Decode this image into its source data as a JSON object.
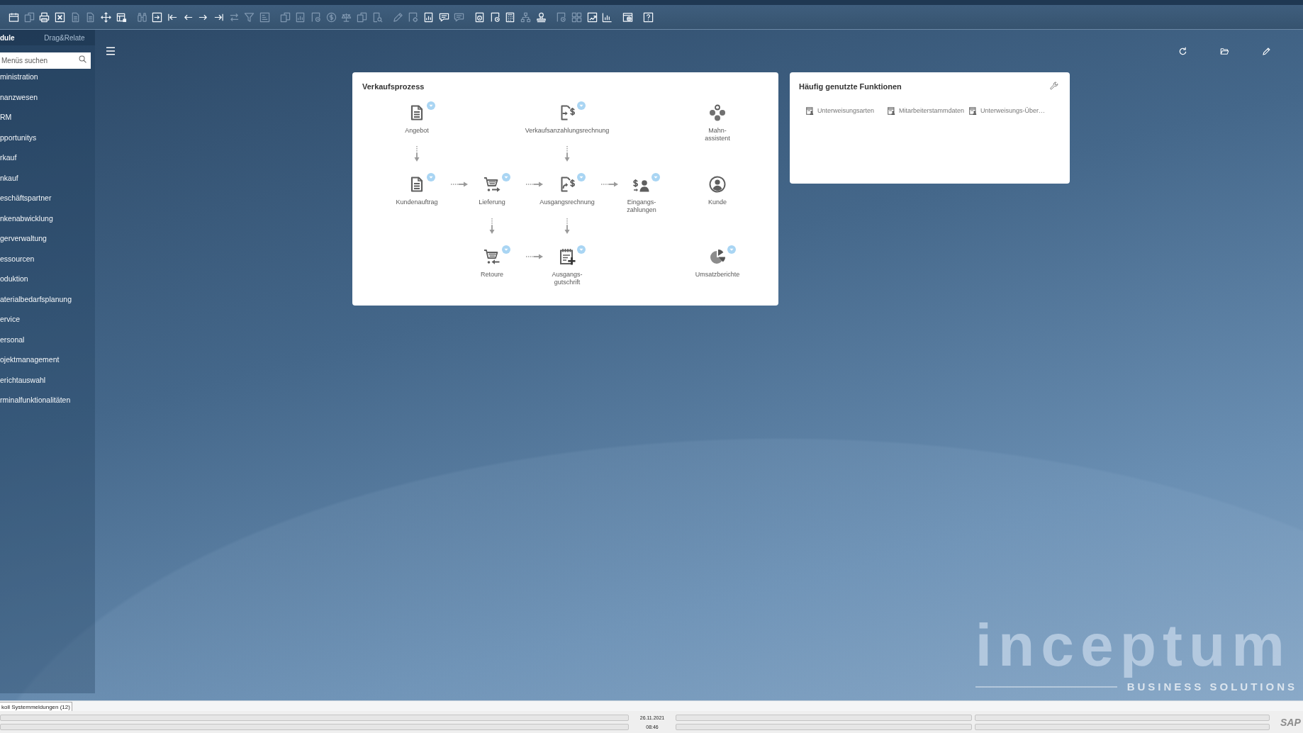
{
  "toolbar": {
    "buttons": [
      {
        "disabled": false
      },
      {
        "disabled": true
      },
      {
        "disabled": false
      },
      {
        "disabled": false
      },
      {
        "disabled": true
      },
      {
        "disabled": true
      },
      {
        "disabled": false
      },
      {
        "disabled": false
      },
      {
        "disabled": true
      },
      {
        "disabled": false
      },
      {
        "disabled": false
      },
      {
        "disabled": false
      },
      {
        "disabled": false
      },
      {
        "disabled": false
      },
      {
        "disabled": true
      },
      {
        "disabled": true
      },
      {
        "disabled": true
      },
      {
        "disabled": true
      },
      {
        "disabled": true
      },
      {
        "disabled": true
      },
      {
        "disabled": true
      },
      {
        "disabled": true
      },
      {
        "disabled": true
      },
      {
        "disabled": true
      },
      {
        "disabled": true
      },
      {
        "disabled": true
      },
      {
        "disabled": false
      },
      {
        "disabled": false
      },
      {
        "disabled": true
      },
      {
        "disabled": false
      },
      {
        "disabled": false
      },
      {
        "disabled": false
      },
      {
        "disabled": true
      },
      {
        "disabled": false
      },
      {
        "disabled": true
      },
      {
        "disabled": true
      },
      {
        "disabled": false
      },
      {
        "disabled": false
      },
      {
        "disabled": false
      },
      {
        "disabled": false
      }
    ]
  },
  "sidebar": {
    "tabs": [
      {
        "label": "dule",
        "selected": true
      },
      {
        "label": "Drag&Relate",
        "selected": false
      }
    ],
    "search": {
      "placeholder": "Menüs suchen"
    },
    "items": [
      {
        "label": "ministration"
      },
      {
        "label": "nanzwesen"
      },
      {
        "label": "RM"
      },
      {
        "label": "pportunitys"
      },
      {
        "label": "rkauf"
      },
      {
        "label": "nkauf"
      },
      {
        "label": "eschäftspartner"
      },
      {
        "label": "nkenabwicklung"
      },
      {
        "label": "gerverwaltung"
      },
      {
        "label": "essourcen"
      },
      {
        "label": "oduktion"
      },
      {
        "label": "aterialbedarfsplanung"
      },
      {
        "label": "ervice"
      },
      {
        "label": "ersonal"
      },
      {
        "label": "ojektmanagement"
      },
      {
        "label": "erichtauswahl"
      },
      {
        "label": "rminalfunktionalitäten"
      }
    ]
  },
  "sales_process": {
    "title": "Verkaufsprozess",
    "nodes": [
      {
        "label": "Angebot",
        "dropdown": true
      },
      {
        "label": "Verkaufsanzahlungsrechnung",
        "dropdown": true
      },
      {
        "label": "Mahn-\nassistent",
        "dropdown": false
      },
      {
        "label": "Kundenauftrag",
        "dropdown": true
      },
      {
        "label": "Lieferung",
        "dropdown": true
      },
      {
        "label": "Ausgangsrechnung",
        "dropdown": true
      },
      {
        "label": "Eingangs-\nzahlungen",
        "dropdown": true
      },
      {
        "label": "Kunde",
        "dropdown": false
      },
      {
        "label": "Retoure",
        "dropdown": true
      },
      {
        "label": "Ausgangs-\ngutschrift",
        "dropdown": true
      },
      {
        "label": "Umsatzberichte",
        "dropdown": true
      }
    ]
  },
  "frequent_functions": {
    "title": "Häufig genutzte Funktionen",
    "items": [
      {
        "label": "Unterweisungsarten"
      },
      {
        "label": "Mitarbeiterstammdaten"
      },
      {
        "label": "Unterweisungs-Über…"
      }
    ]
  },
  "background_logo": {
    "wordmark": "inceptum",
    "tagline": "BUSINESS SOLUTIONS"
  },
  "message_log": {
    "tab": "koll Systemmeldungen (12)"
  },
  "status_bar": {
    "date": "26.11.2021",
    "time": "08:46",
    "logo": "SAP"
  }
}
